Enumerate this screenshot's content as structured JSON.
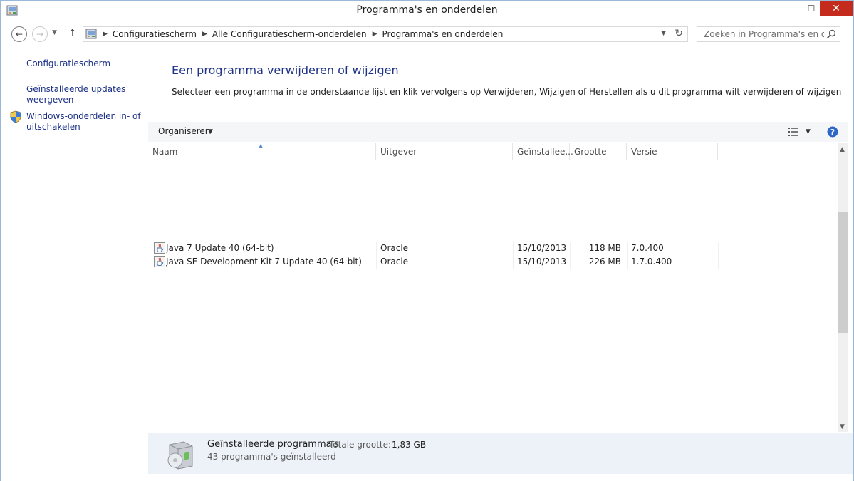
{
  "window": {
    "title": "Programma's en onderdelen",
    "minimize_glyph": "—",
    "maximize_glyph": "☐",
    "close_glyph": "✕"
  },
  "nav": {
    "back_glyph": "←",
    "forward_glyph": "→",
    "recent_glyph": "▼",
    "up_glyph": "↑",
    "breadcrumbs": [
      "Configuratiescherm",
      "Alle Configuratiescherm-onderdelen",
      "Programma's en onderdelen"
    ],
    "separator_glyph": "▶",
    "dropdown_glyph": "▼",
    "refresh_glyph": "↻",
    "search_placeholder": "Zoeken in Programma's en o..."
  },
  "sidebar": {
    "items": [
      {
        "label": "Configuratiescherm"
      },
      {
        "label": "Geïnstalleerde updates weergeven"
      },
      {
        "label": "Windows-onderdelen in- of uitschakelen",
        "icon": "shield-icon"
      }
    ]
  },
  "main": {
    "heading": "Een programma verwijderen of wijzigen",
    "description": "Selecteer een programma in de onderstaande lijst en klik vervolgens op Verwijderen, Wijzigen of Herstellen als u dit programma wilt verwijderen of wijzigen."
  },
  "toolbar": {
    "organize_label": "Organiseren",
    "organize_arrow": "▼",
    "view_arrow": "▼"
  },
  "list": {
    "sort_glyph": "▲",
    "columns": [
      "Naam",
      "Uitgever",
      "Geïnstallee...",
      "Grootte",
      "Versie"
    ],
    "rows": [
      {
        "name": "Java 7 Update 40 (64-bit)",
        "publisher": "Oracle",
        "installed": "15/10/2013",
        "size": "118 MB",
        "version": "7.0.400"
      },
      {
        "name": "Java SE Development Kit 7 Update 40 (64-bit)",
        "publisher": "Oracle",
        "installed": "15/10/2013",
        "size": "226 MB",
        "version": "1.7.0.400"
      }
    ]
  },
  "scrollbar": {
    "up_glyph": "▲",
    "down_glyph": "▼"
  },
  "details": {
    "title": "Geïnstalleerde programma's",
    "total_label": "Totale grootte:",
    "total_value": "1,83 GB",
    "count_text": "43 programma's geïnstalleerd"
  },
  "colors": {
    "link": "#1e3287",
    "close_button": "#c42b1c",
    "details_bg": "#edf2f9"
  }
}
